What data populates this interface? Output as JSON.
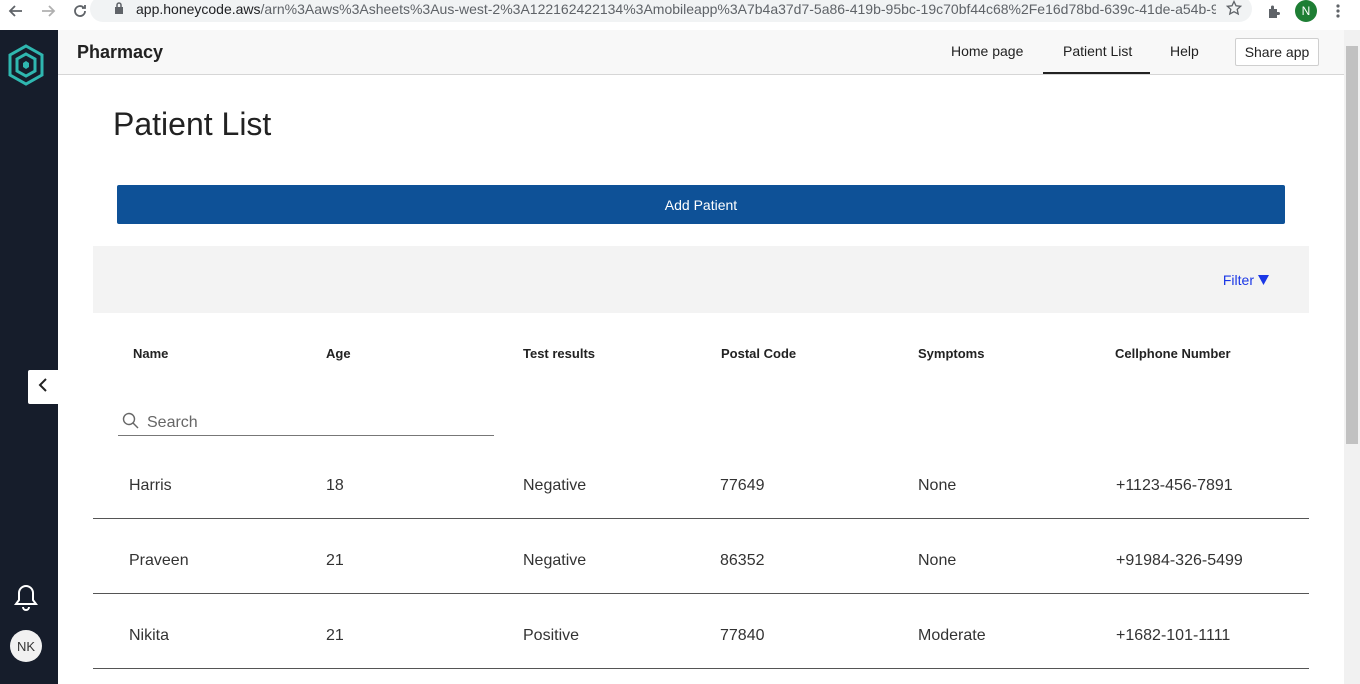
{
  "browser": {
    "url_host": "app.honeycode.aws",
    "url_rest": "/arn%3Aaws%3Asheets%3Aus-west-2%3A122162422134%3Amobileapp%3A7b4a37d7-5a86-419b-95bc-19c70bf44c68%2Fe16d78bd-639c-41de-a54b-9...",
    "profile_initial": "N"
  },
  "app": {
    "title": "Pharmacy",
    "tabs": [
      {
        "label": "Home page"
      },
      {
        "label": "Patient List"
      },
      {
        "label": "Help"
      }
    ],
    "share_label": "Share app",
    "user_initials": "NK"
  },
  "page": {
    "title": "Patient List",
    "add_button": "Add Patient",
    "filter_label": "Filter",
    "search_placeholder": "Search"
  },
  "table": {
    "columns": [
      "Name",
      "Age",
      "Test results",
      "Postal Code",
      "Symptoms",
      "Cellphone Number"
    ],
    "rows": [
      [
        "Harris",
        "18",
        "Negative",
        "77649",
        "None",
        "+1123-456-7891"
      ],
      [
        "Praveen",
        "21",
        "Negative",
        "86352",
        "None",
        "+91984-326-5499"
      ],
      [
        "Nikita",
        "21",
        "Positive",
        "77840",
        "Moderate",
        "+1682-101-1111"
      ]
    ]
  },
  "colors": {
    "rail": "#161d2b",
    "primary_button": "#0e5197",
    "filter_link": "#1a37e6",
    "logo_accent": "#2fb7b0"
  }
}
